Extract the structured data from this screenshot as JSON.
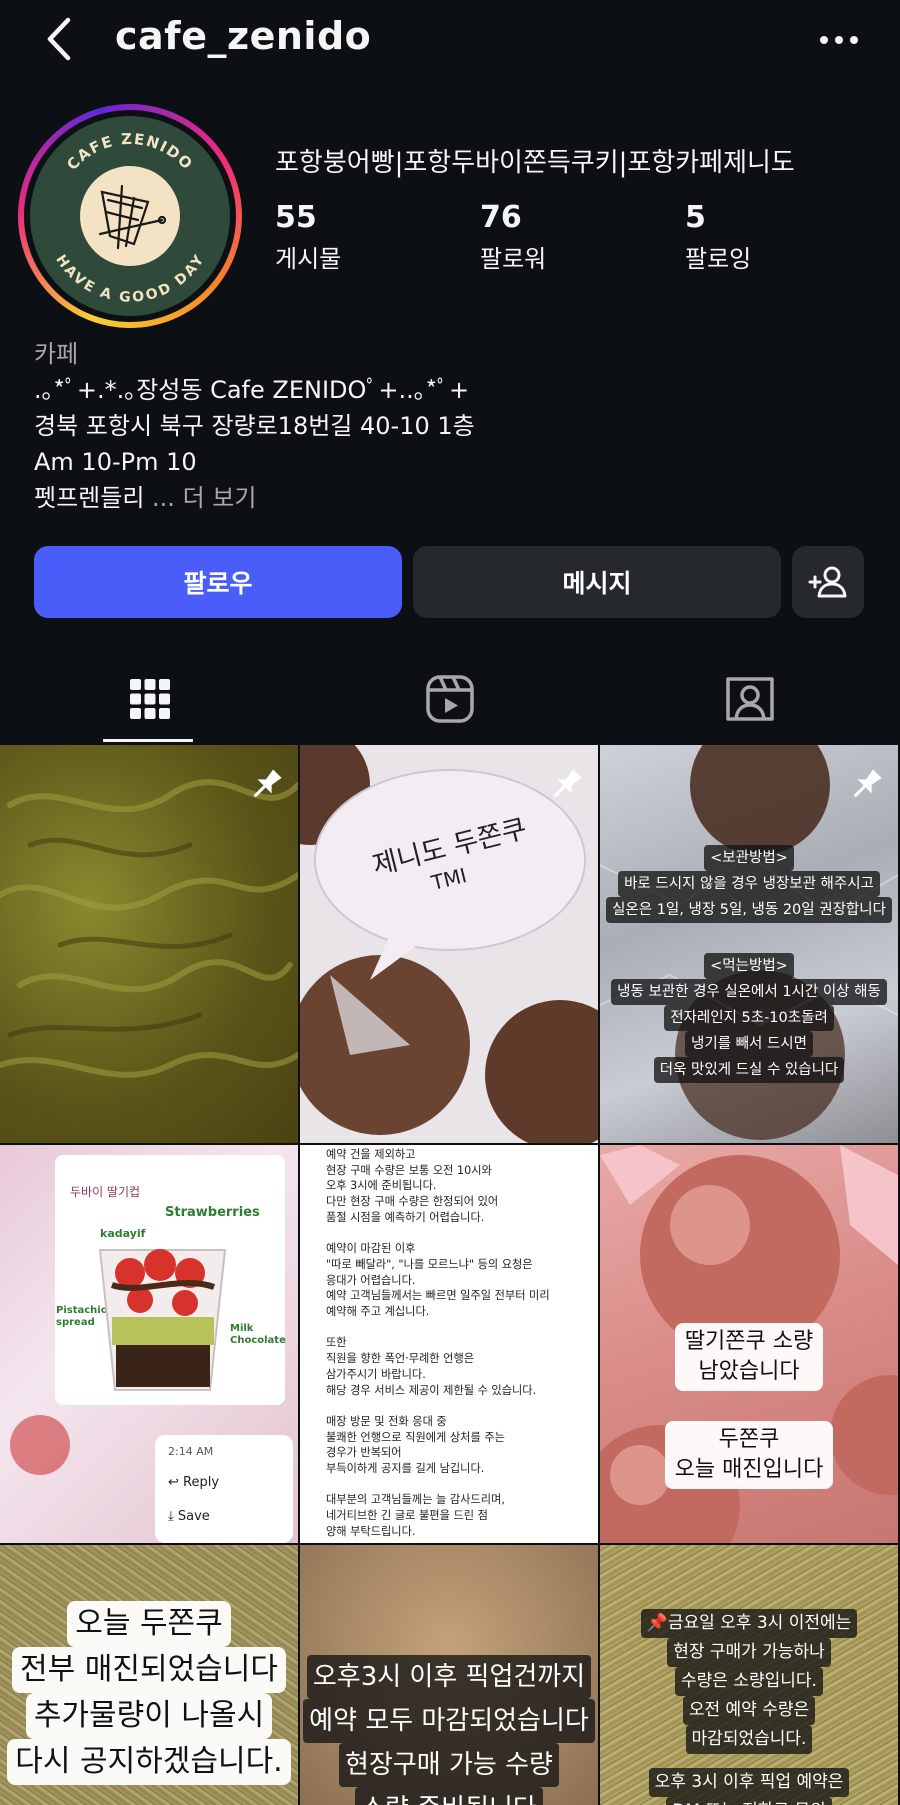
{
  "header": {
    "username": "cafe_zenido"
  },
  "profile": {
    "display_name": "포항붕어빵|포항두바이쫀득쿠키|포항카페제니도",
    "avatar": {
      "ring_text_top": "CAFE ZENIDO",
      "ring_text_bottom": "HAVE A GOOD DAY"
    },
    "stats": [
      {
        "value": "55",
        "label": "게시물"
      },
      {
        "value": "76",
        "label": "팔로워"
      },
      {
        "value": "5",
        "label": "팔로잉"
      }
    ],
    "category": "카페",
    "bio_lines": [
      ".｡*ﾟ+.*.｡장성동 Cafe ZENIDOﾟ+..｡*ﾟ+",
      "경북 포항시 북구 장량로18번길 40-10 1층",
      "Am 10-Pm 10",
      "펫프렌들리"
    ],
    "more_label": "... 더 보기"
  },
  "actions": {
    "follow_label": "팔로우",
    "message_label": "메시지"
  },
  "tabs": [
    {
      "name": "posts-grid",
      "icon": "grid-icon",
      "active": true
    },
    {
      "name": "reels",
      "icon": "reels-icon",
      "active": false
    },
    {
      "name": "tagged",
      "icon": "tagged-user-icon",
      "active": false
    }
  ],
  "posts": [
    {
      "pinned": true,
      "caption": ""
    },
    {
      "pinned": true,
      "caption_lines": [
        "제니도 두쫀쿠",
        "TMI"
      ]
    },
    {
      "pinned": true,
      "caption_lines": [
        "<보관방법>",
        "바로 드시지 않을 경우 냉장보관 해주시고",
        "실온은 1일, 냉장 5일, 냉동 20일 권장합니다",
        "<먹는방법>",
        "냉동 보관한 경우 실온에서 1시간 이상 해동",
        "전자레인지 5초-10초돌려",
        "냉기를 빼서 드시면",
        "더욱 맛있게 드실 수 있습니다"
      ]
    },
    {
      "pinned": false,
      "caption_lines": [
        "두바이 딸기컵",
        "Strawberries",
        "kadayif",
        "Pistachio spread",
        "Milk Chocolate",
        "2:14 AM",
        "Reply",
        "Save"
      ]
    },
    {
      "pinned": false,
      "caption_lines": [
        "예약 건을 제외하고",
        "현장 구매 수량은 보통 오전 10시와",
        "오후 3시에 준비됩니다.",
        "다만 현장 구매 수량은 한정되어 있어",
        "품절 시점을 예측하기 어렵습니다.",
        "",
        "예약이 마감된 이후",
        "\"따로 빼달라\", \"나를 모르느냐\" 등의 요청은",
        "응대가 어렵습니다.",
        "예약 고객님들께서는 빠르면 일주일 전부터 미리",
        "예약해 주고 계십니다.",
        "",
        "또한",
        "직원을 향한 폭언·무례한 언행은",
        "삼가주시기 바랍니다.",
        "해당 경우 서비스 제공이 제한될 수 있습니다.",
        "",
        "매장 방문 및 전화 응대 중",
        "불쾌한 언행으로 직원에게 상처를 주는",
        "경우가 반복되어",
        "부득이하게 공지를 길게 남깁니다.",
        "",
        "대부분의 고객님들께는 늘 감사드리며,",
        "네거티브한 긴 글로 불편을 드린 점",
        "양해 부탁드립니다."
      ]
    },
    {
      "pinned": false,
      "caption_lines": [
        "딸기쫀쿠 소량",
        "남았습니다",
        "두쫀쿠",
        "오늘 매진입니다"
      ]
    },
    {
      "pinned": false,
      "caption_lines": [
        "오늘 두쫀쿠",
        "전부 매진되었습니다",
        "추가물량이 나올시",
        "다시 공지하겠습니다."
      ]
    },
    {
      "pinned": false,
      "caption_lines": [
        "오후3시 이후 픽업건까지",
        "예약 모두 마감되었습니다",
        "현장구매 가능 수량",
        "소량 준비됩니다"
      ]
    },
    {
      "pinned": false,
      "caption_lines": [
        "📌금요일 오후 3시 이전에는",
        "현장 구매가 가능하나",
        "수량은 소량입니다.",
        "오전 예약 수량은",
        "마감되었습니다.",
        "오후 3시 이후 픽업 예약은",
        "DM 또는 전화로 문의"
      ]
    }
  ],
  "colors": {
    "background": "#0c1014",
    "follow_button": "#4a5df9",
    "secondary_button": "#25292e",
    "avatar_green": "#2f4a3a",
    "avatar_cream": "#f3e2c4"
  }
}
